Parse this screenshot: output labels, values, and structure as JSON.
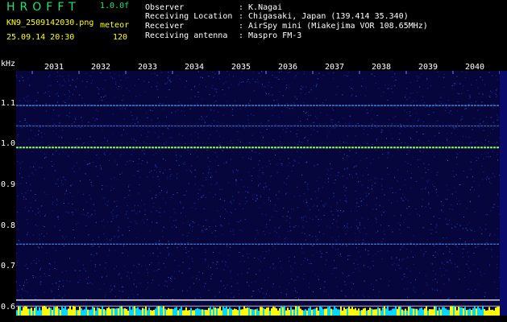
{
  "header": {
    "app_title": "HROFFT",
    "version": "1.0.0f",
    "filename": "KN9_2509142030.png",
    "datetime": "25.09.14 20:30",
    "mode": "meteor",
    "count": "120",
    "fields": [
      {
        "label": "Observer",
        "value": ": K.Nagai"
      },
      {
        "label": "Receiving Location",
        "value": ": Chigasaki, Japan (139.414 35.340)"
      },
      {
        "label": "Receiver",
        "value": ": AirSpy mini (Miakejima VOR 108.65MHz)"
      },
      {
        "label": "Receiving antenna",
        "value": ": Maspro FM-3"
      }
    ]
  },
  "axis": {
    "y_unit": "kHz",
    "y_ticks": [
      {
        "label": "1.1",
        "value": 1.1
      },
      {
        "label": "1.0",
        "value": 1.0
      },
      {
        "label": "0.9",
        "value": 0.9
      },
      {
        "label": "0.8",
        "value": 0.8
      },
      {
        "label": "0.7",
        "value": 0.7
      },
      {
        "label": "0.6",
        "value": 0.6
      }
    ],
    "y_range": [
      0.58,
      1.18
    ],
    "time_labels": [
      "2031",
      "2032",
      "2033",
      "2034",
      "2035",
      "2036",
      "2037",
      "2038",
      "2039",
      "2040"
    ]
  },
  "spectrogram": {
    "background": "#06063c",
    "traces": [
      {
        "freq": 1.095,
        "color": "#4fa8ff",
        "opacity": 0.85
      },
      {
        "freq": 1.045,
        "color": "#3f7fe0",
        "opacity": 0.7
      },
      {
        "freq": 0.992,
        "color": "#7dff5a",
        "opacity": 1.0
      },
      {
        "freq": 0.755,
        "color": "#3f8ff0",
        "opacity": 0.8
      },
      {
        "freq": 0.618,
        "color": "#f0f0f0",
        "opacity": 0.9
      },
      {
        "freq": 0.603,
        "color": "#bcbcbc",
        "opacity": 0.7
      }
    ],
    "baseline_colors": [
      "#ffff00",
      "#00d8ff"
    ]
  }
}
